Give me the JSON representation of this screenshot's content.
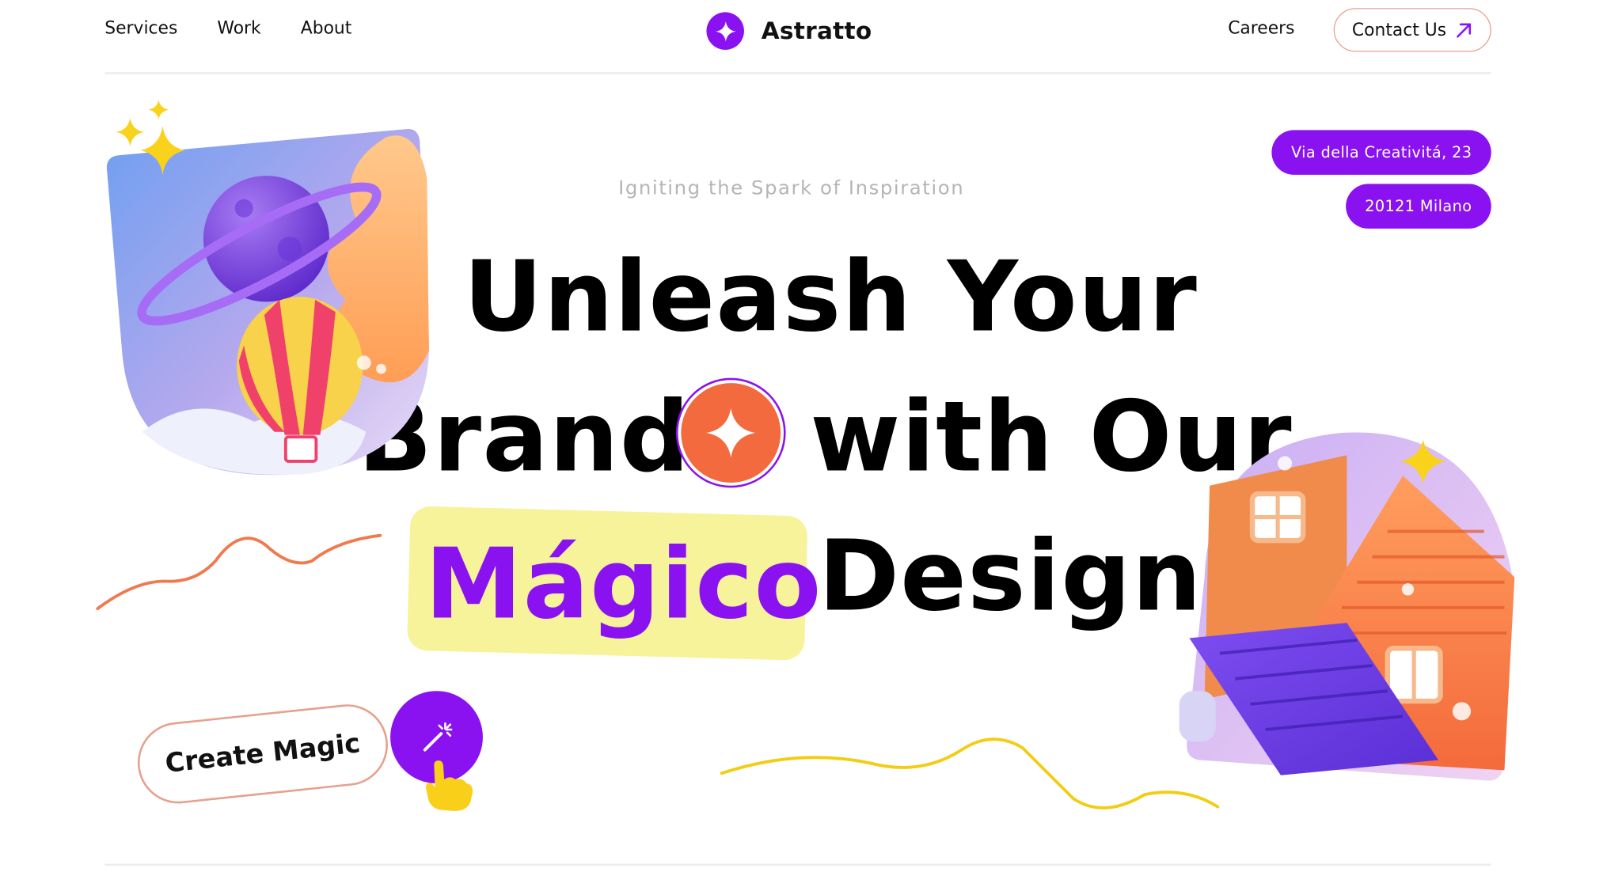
{
  "header": {
    "nav": [
      "Services",
      "Work",
      "About"
    ],
    "brand_name": "Astratto",
    "careers": "Careers",
    "contact_label": "Contact Us"
  },
  "address": {
    "line1": "Via della Creativitá, 23",
    "line2": "20121 Milano"
  },
  "hero": {
    "tagline": "Igniting the Spark of Inspiration",
    "line1": "Unleash Your",
    "line2_a": "Brand",
    "line2_b": "with Our",
    "line3_highlight": "Mágico",
    "line3_b": "Design",
    "cta_label": "Create Magic"
  },
  "icons": [
    "star-logo-icon",
    "arrow-up-right-icon",
    "magic-wand-icon",
    "pointer-hand-icon",
    "sparkle-icon"
  ],
  "colors": {
    "accent": "#8b12f0",
    "orange": "#f26a3d",
    "highlight": "#f7f39a",
    "outline": "#e7a08d",
    "squiggle_orange": "#f07a4f",
    "squiggle_yellow": "#f2cd12"
  }
}
